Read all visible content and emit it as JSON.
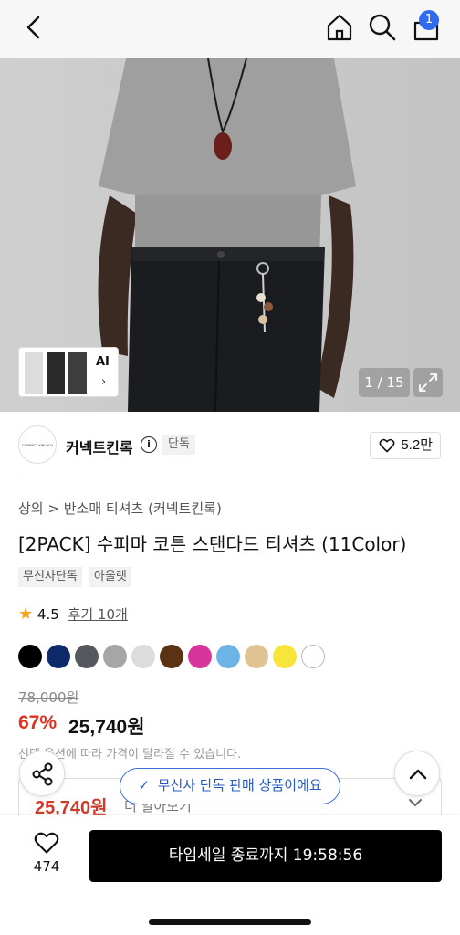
{
  "header": {
    "cart_count": "1",
    "icons": [
      "back-arrow-icon",
      "home-icon",
      "search-icon",
      "cart-icon"
    ]
  },
  "gallery": {
    "ai_label": "AI",
    "ai_chevron": "›",
    "counter": "1 / 15"
  },
  "brand": {
    "logo_text": "CONNECT KINLOCH",
    "name": "커넥트킨록",
    "badge": "단독",
    "like_count": "5.2만"
  },
  "product": {
    "breadcrumb": [
      "상의",
      "반소매 티셔츠",
      "(커넥트킨록)"
    ],
    "title": "[2PACK] 수피마 코튼 스탠다드 티셔츠 (11Color)",
    "tags": [
      "무신사단독",
      "아울렛"
    ],
    "rating": "4.5",
    "reviews": "후기 10개",
    "swatches": [
      "#000000",
      "#0f2a6b",
      "#55585c",
      "#a6a6a6",
      "#dcdcdc",
      "#5b3212",
      "#d9349c",
      "#6db4e6",
      "#dfc393",
      "#f7e53b",
      "#ffffff"
    ],
    "original_price": "78,000원",
    "discount": "67%",
    "price": "25,740원",
    "price_note": "선택 옵션에 따라 가격이 달라질 수 있습니다.",
    "option_price": "25,740원",
    "option_extra": "더 알아보기"
  },
  "floating": {
    "exclusive_pill": "무신사 단독 판매 상품이에요",
    "check": "✓"
  },
  "bottom": {
    "wish_count": "474",
    "cta_label": "타임세일 종료까지 19:58:56"
  }
}
